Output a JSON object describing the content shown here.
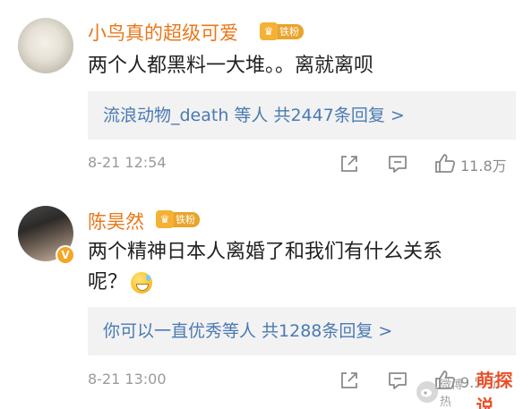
{
  "comments": [
    {
      "username": "小鸟真的超级可爱",
      "fan_badge": "铁粉",
      "content": "两个人都黑料一大堆。。离就离呗",
      "reply_summary": "流浪动物_death 等人 共2447条回复 >",
      "timestamp": "8-21 12:54",
      "like_count": "11.8万"
    },
    {
      "username": "陈昊然",
      "fan_badge": "铁粉",
      "content_line1": "两个精神日本人离婚了和我们有什么关系",
      "content_line2": "呢？",
      "reply_summary": "你可以一直优秀等人 共1288条回复 >",
      "timestamp": "8-21 13:00",
      "like_count": "9.5万"
    }
  ],
  "watermark": {
    "text": "微博热",
    "brand": "萌探说"
  },
  "colors": {
    "username": "#e8781a",
    "link": "#4a7ab3",
    "reply_bg": "#f2f2f2",
    "meta_gray": "#9a9a9a",
    "badge_orange": "#f4b136"
  },
  "icons": [
    "share-icon",
    "comment-icon",
    "like-icon",
    "crown-icon",
    "verified-v-icon",
    "grin-sweat-emoji"
  ]
}
